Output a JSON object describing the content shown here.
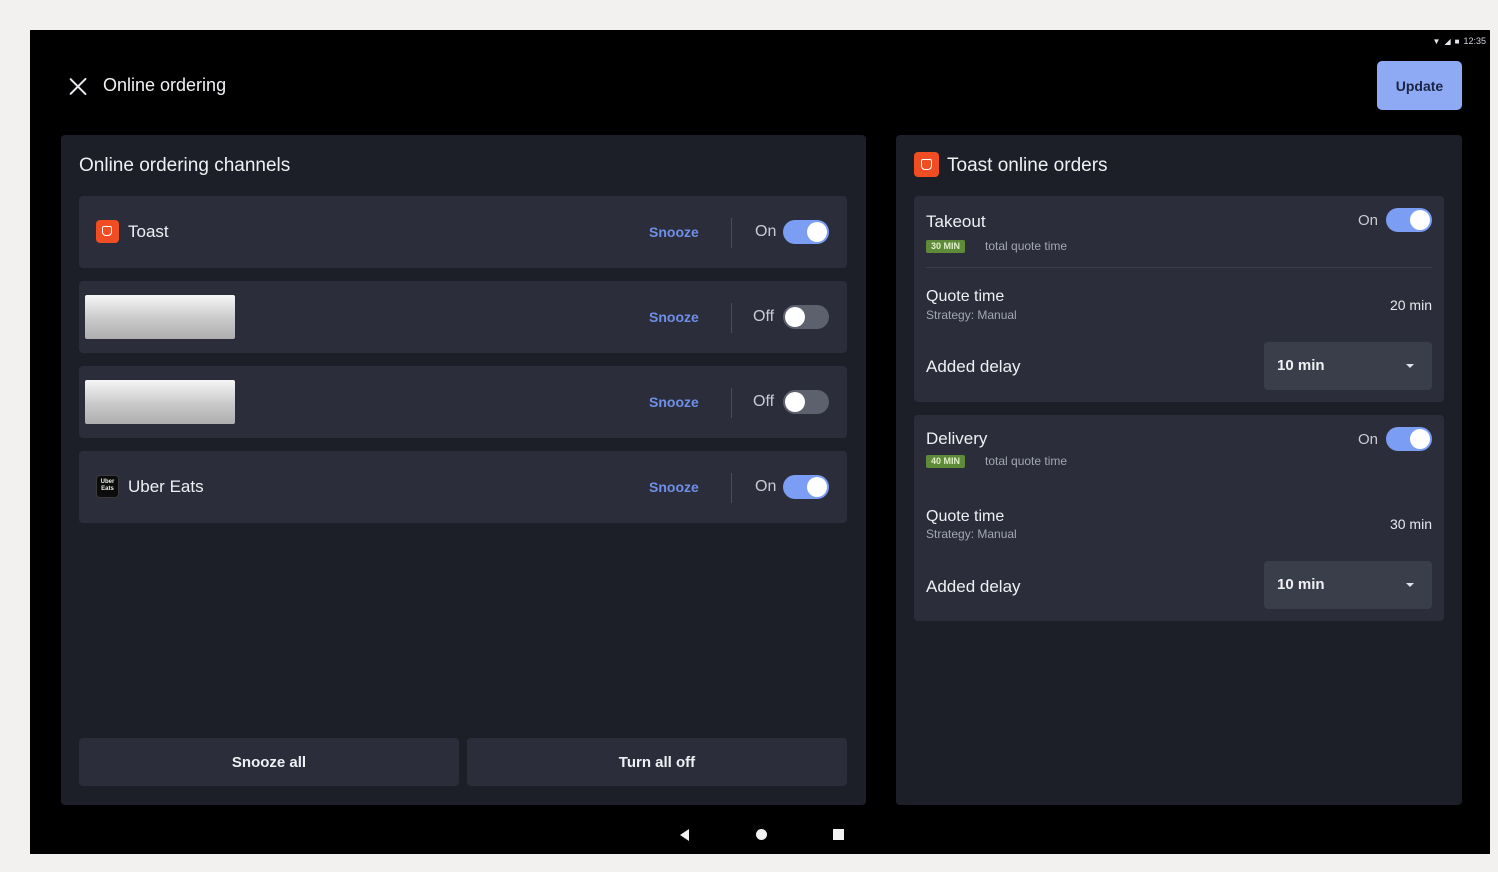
{
  "status_bar": {
    "time": "12:35",
    "icons": [
      "wifi-icon",
      "signal-icon",
      "battery-icon"
    ]
  },
  "header": {
    "title": "Online ordering",
    "close_icon": "close-icon",
    "update_label": "Update"
  },
  "channels_panel": {
    "title": "Online ordering channels",
    "channels": [
      {
        "name": "Toast",
        "icon": "toast-logo",
        "snooze_label": "Snooze",
        "state": "On",
        "enabled": true
      },
      {
        "name": "",
        "icon": "partner-logo-placeholder",
        "snooze_label": "Snooze",
        "state": "Off",
        "enabled": false
      },
      {
        "name": "",
        "icon": "partner-logo-placeholder",
        "snooze_label": "Snooze",
        "state": "Off",
        "enabled": false
      },
      {
        "name": "Uber Eats",
        "icon": "uber-eats-logo",
        "icon_text": "Uber Eats",
        "snooze_label": "Snooze",
        "state": "On",
        "enabled": true
      }
    ],
    "snooze_all_label": "Snooze all",
    "turn_all_off_label": "Turn all off"
  },
  "toast_orders_panel": {
    "title": "Toast online orders",
    "takeout": {
      "label": "Takeout",
      "state": "On",
      "enabled": true,
      "badge": "30 MIN",
      "badge_caption": "total quote time",
      "quote_time_label": "Quote time",
      "strategy": "Strategy: Manual",
      "quote_time_value": "20 min",
      "added_delay_label": "Added delay",
      "added_delay_value": "10 min"
    },
    "delivery": {
      "label": "Delivery",
      "state": "On",
      "enabled": true,
      "badge": "40 MIN",
      "badge_caption": "total quote time",
      "quote_time_label": "Quote time",
      "strategy": "Strategy: Manual",
      "quote_time_value": "30 min",
      "added_delay_label": "Added delay",
      "added_delay_value": "10 min"
    }
  },
  "nav_bar": {
    "icons": [
      "back-icon",
      "home-icon",
      "recents-icon"
    ]
  },
  "colors": {
    "accent": "#8eaaf5",
    "toggle_on": "#7b9df4",
    "toggle_off": "#5d616d",
    "snooze_link": "#6f8fe8",
    "toast_brand": "#f04d23",
    "badge_green": "#5f8a3a",
    "panel_bg": "#1d1f28",
    "row_bg": "#2b2e3a"
  }
}
